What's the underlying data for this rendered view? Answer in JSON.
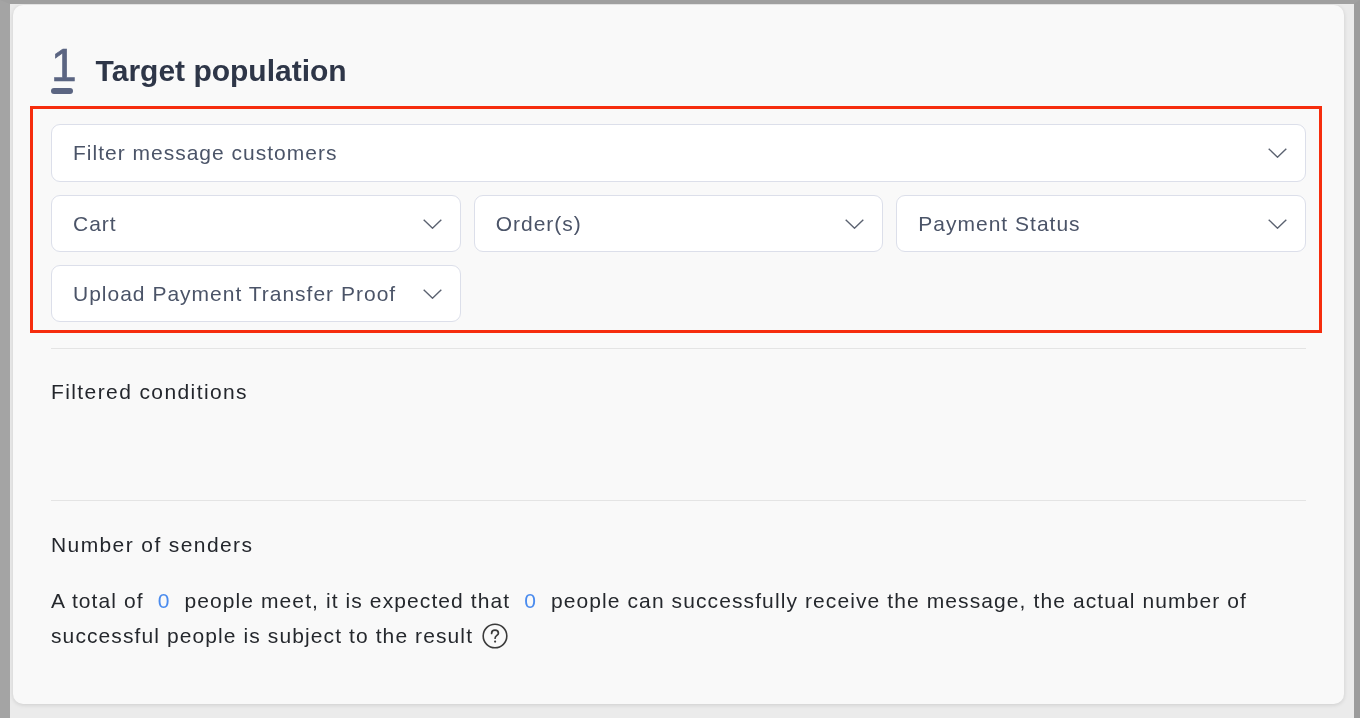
{
  "section": {
    "step": "1",
    "title": "Target population"
  },
  "filters": {
    "highlighted": true,
    "customer_filter": {
      "placeholder": "Filter message customers"
    },
    "condition_filters": [
      {
        "placeholder": "Cart"
      },
      {
        "placeholder": "Order(s)"
      },
      {
        "placeholder": "Payment Status"
      },
      {
        "placeholder": "Upload Payment Transfer Proof"
      }
    ]
  },
  "conditions": {
    "title": "Filtered conditions"
  },
  "senders": {
    "title": "Number of senders",
    "summary": {
      "before": "A total of",
      "total": "0",
      "middle": "people meet, it is expected that",
      "expected": "0",
      "after": "people can successfully receive the message, the actual number of",
      "ending": "successful people is subject to the result"
    }
  }
}
